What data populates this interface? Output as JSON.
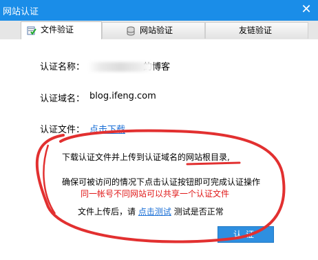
{
  "window": {
    "title": "网站认证",
    "close_symbol": "✕"
  },
  "tabs": [
    {
      "label": "文件验证",
      "active": true,
      "icon": "file-check-icon"
    },
    {
      "label": "网站验证",
      "active": false,
      "icon": "database-icon"
    },
    {
      "label": "友链验证",
      "active": false,
      "icon": "none"
    }
  ],
  "form": {
    "name_label": "认证名称：",
    "name_value_suffix": "的博客",
    "domain_label": "认证域名：",
    "domain_value": "blog.ifeng.com",
    "file_label": "认证文件：",
    "download_link": "点击下载"
  },
  "instructions": {
    "line1": "下载认证文件并上传到认证域名的网站根目录,",
    "line2": "确保可被访问的情况下点击认证按钮即可完成认证操作",
    "line3_red": "同一帐号不同网站可以共享一个认证文件",
    "line4_prefix": "文件上传后，请",
    "line4_link": "点击测试",
    "line4_suffix": "测试是否正常"
  },
  "verify_button": "认证",
  "colors": {
    "titlebar": "#1a8de8",
    "accent_red": "#e01818",
    "link": "#1a6fd6",
    "button": "#2e8fe0"
  }
}
